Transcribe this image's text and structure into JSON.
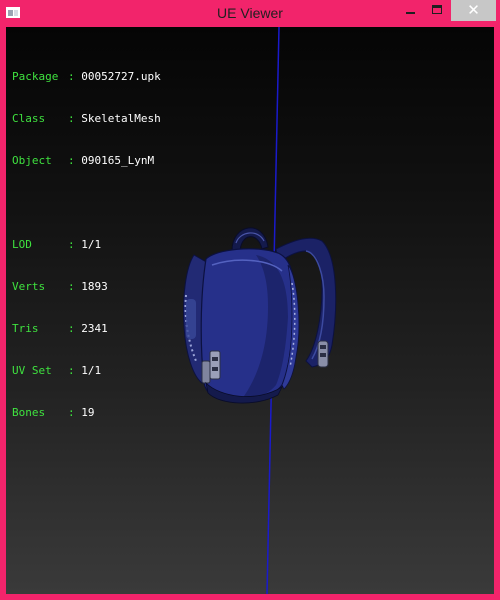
{
  "window": {
    "title": "UE Viewer",
    "close_glyph": "✕",
    "icons": {
      "app": "app-icon",
      "minimize": "minimize-icon",
      "maximize": "maximize-icon",
      "close": "close-icon"
    },
    "colors": {
      "frame": "#f2246b",
      "close_button": "#c7c7c7"
    }
  },
  "info": {
    "separator": ":",
    "rows": [
      {
        "label": "Package",
        "value": "00052727.upk"
      },
      {
        "label": "Class",
        "value": "SkeletalMesh"
      },
      {
        "label": "Object",
        "value": "090165_LynM"
      }
    ],
    "stats": [
      {
        "label": "LOD",
        "value": "1/1"
      },
      {
        "label": "Verts",
        "value": "1893"
      },
      {
        "label": "Tris",
        "value": "2341"
      },
      {
        "label": "UV Set",
        "value": "1/1"
      },
      {
        "label": "Bones",
        "value": "19"
      }
    ],
    "colors": {
      "label": "#3fe23f",
      "value": "#ffffff"
    }
  },
  "viewport": {
    "axis_color": "#1a1acc",
    "mesh_color": "#1e2570"
  }
}
